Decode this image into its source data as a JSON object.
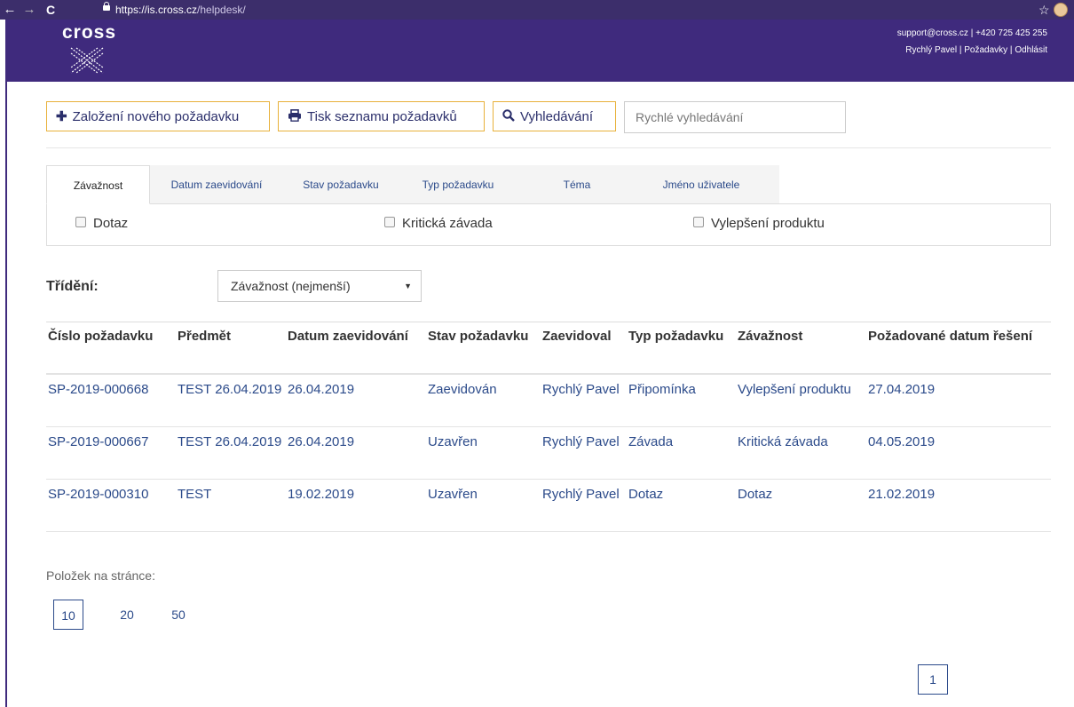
{
  "browser": {
    "url_host": "https://is.cross.cz",
    "url_path": "/helpdesk/"
  },
  "header": {
    "logo": "cross",
    "support": "support@cross.cz | +420 725 425 255",
    "user": "Rychlý Pavel",
    "requests_link": "Požadavky",
    "logout_link": "Odhlásit"
  },
  "toolbar": {
    "new_label": "Založení nového požadavku",
    "print_label": "Tisk seznamu požadavků",
    "search_label": "Vyhledávání",
    "quick_placeholder": "Rychlé vyhledávání"
  },
  "filter_tabs": [
    "Závažnost",
    "Datum zaevidování",
    "Stav požadavku",
    "Typ požadavku",
    "Téma",
    "Jméno uživatele"
  ],
  "filter_options": [
    "Dotaz",
    "Kritická závada",
    "Vylepšení produktu"
  ],
  "sorting": {
    "label": "Třídění:",
    "selected": "Závažnost (nejmenší)"
  },
  "table": {
    "headers": [
      "Číslo požadavku",
      "Předmět",
      "Datum zaevidování",
      "Stav požadavku",
      "Zaevidoval",
      "Typ požadavku",
      "Závažnost",
      "Požadované datum řešení"
    ],
    "rows": [
      [
        "SP-2019-000668",
        "TEST 26.04.2019",
        "26.04.2019",
        "Zaevidován",
        "Rychlý Pavel",
        "Připomínka",
        "Vylepšení produktu",
        "27.04.2019"
      ],
      [
        "SP-2019-000667",
        "TEST 26.04.2019",
        "26.04.2019",
        "Uzavřen",
        "Rychlý Pavel",
        "Závada",
        "Kritická závada",
        "04.05.2019"
      ],
      [
        "SP-2019-000310",
        "TEST",
        "19.02.2019",
        "Uzavřen",
        "Rychlý Pavel",
        "Dotaz",
        "Dotaz",
        "21.02.2019"
      ]
    ]
  },
  "pagination": {
    "per_page_label": "Položek na stránce:",
    "per_page_options": [
      "10",
      "20",
      "50"
    ],
    "current_page": "1"
  }
}
